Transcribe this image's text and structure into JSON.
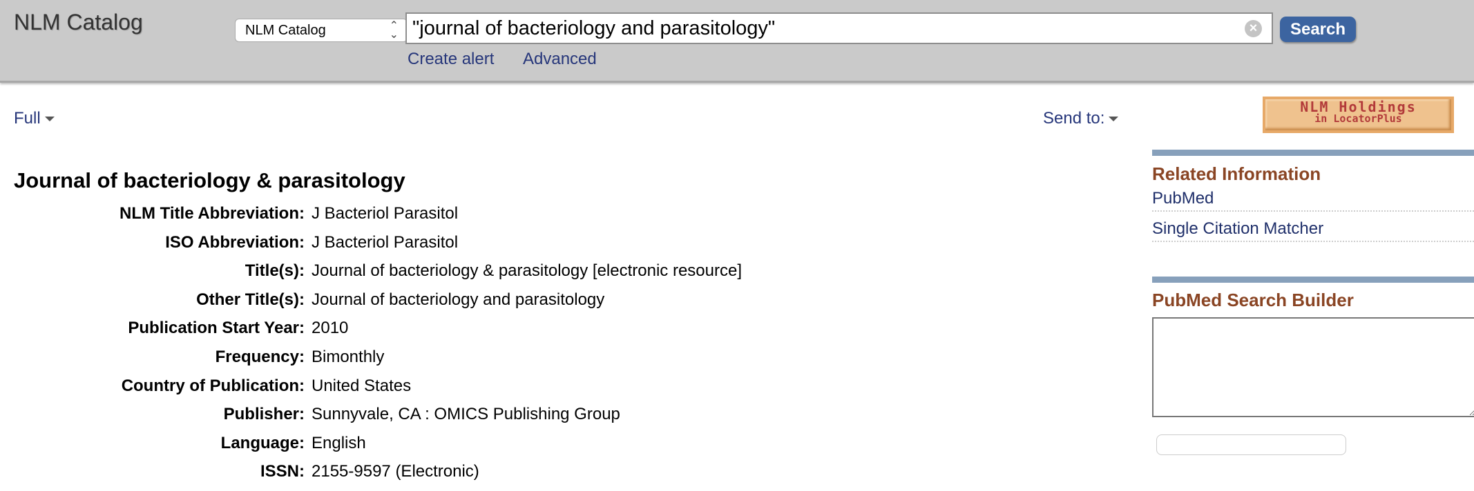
{
  "header": {
    "app_title": "NLM Catalog",
    "database_select": "NLM Catalog",
    "search_value": "\"journal of bacteriology and parasitology\"",
    "search_button": "Search",
    "links": [
      "Create alert",
      "Advanced"
    ]
  },
  "toolbar": {
    "format": "Full",
    "send_to": "Send to:"
  },
  "holdings_button": {
    "line1": "NLM Holdings",
    "line2": "in LocatorPlus"
  },
  "record": {
    "title": "Journal of bacteriology & parasitology",
    "fields": [
      {
        "label": "NLM Title Abbreviation:",
        "value": "J Bacteriol Parasitol"
      },
      {
        "label": "ISO Abbreviation:",
        "value": "J Bacteriol Parasitol"
      },
      {
        "label": "Title(s):",
        "value": "Journal of bacteriology & parasitology [electronic resource]"
      },
      {
        "label": "Other Title(s):",
        "value": "Journal of bacteriology and parasitology"
      },
      {
        "label": "Publication Start Year:",
        "value": "2010"
      },
      {
        "label": "Frequency:",
        "value": "Bimonthly"
      },
      {
        "label": "Country of Publication:",
        "value": "United States"
      },
      {
        "label": "Publisher:",
        "value": "Sunnyvale, CA : OMICS Publishing Group"
      },
      {
        "label": "Language:",
        "value": "English"
      },
      {
        "label": "ISSN:",
        "value": "2155-9597 (Electronic)"
      }
    ]
  },
  "sidebar": {
    "related_heading": "Related Information",
    "related_links": [
      "PubMed",
      "Single Citation Matcher"
    ],
    "builder_heading": "PubMed Search Builder",
    "builder_value": ""
  },
  "colors": {
    "header_bg": "#cacaca",
    "link": "#26367a",
    "section_heading": "#8a4524",
    "section_bar": "#87a0bb",
    "search_button": "#3c64a0"
  }
}
